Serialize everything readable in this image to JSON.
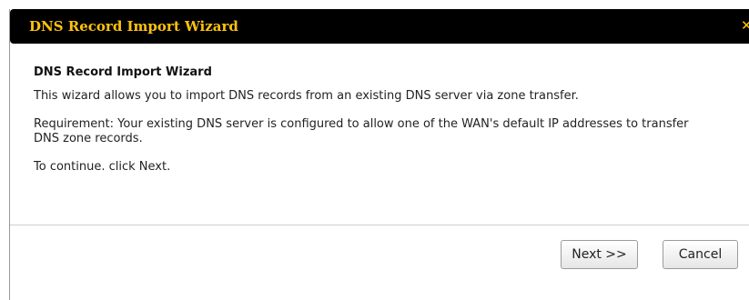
{
  "dialog": {
    "title": "DNS Record Import Wizard",
    "close_icon": "close-icon",
    "heading": "DNS Record Import Wizard",
    "intro": "This wizard allows you to import DNS records from an existing DNS server via zone transfer.",
    "requirement": "Requirement: Your existing DNS server is configured to allow one of the WAN's default IP addresses to transfer DNS zone records.",
    "instruction": "To continue. click Next."
  },
  "buttons": {
    "next_label": "Next >>",
    "cancel_label": "Cancel"
  },
  "colors": {
    "titlebar_bg": "#000000",
    "title_text": "#ffc20e"
  }
}
